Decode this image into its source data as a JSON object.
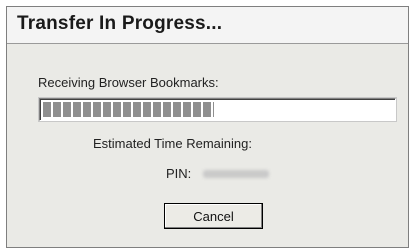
{
  "dialog": {
    "title": "Transfer In Progress...",
    "receiving_label": "Receiving Browser Bookmarks:",
    "progress_fraction": 0.49,
    "eta_label": "Estimated Time Remaining:",
    "pin_label": "PIN:",
    "cancel_label": "Cancel"
  }
}
